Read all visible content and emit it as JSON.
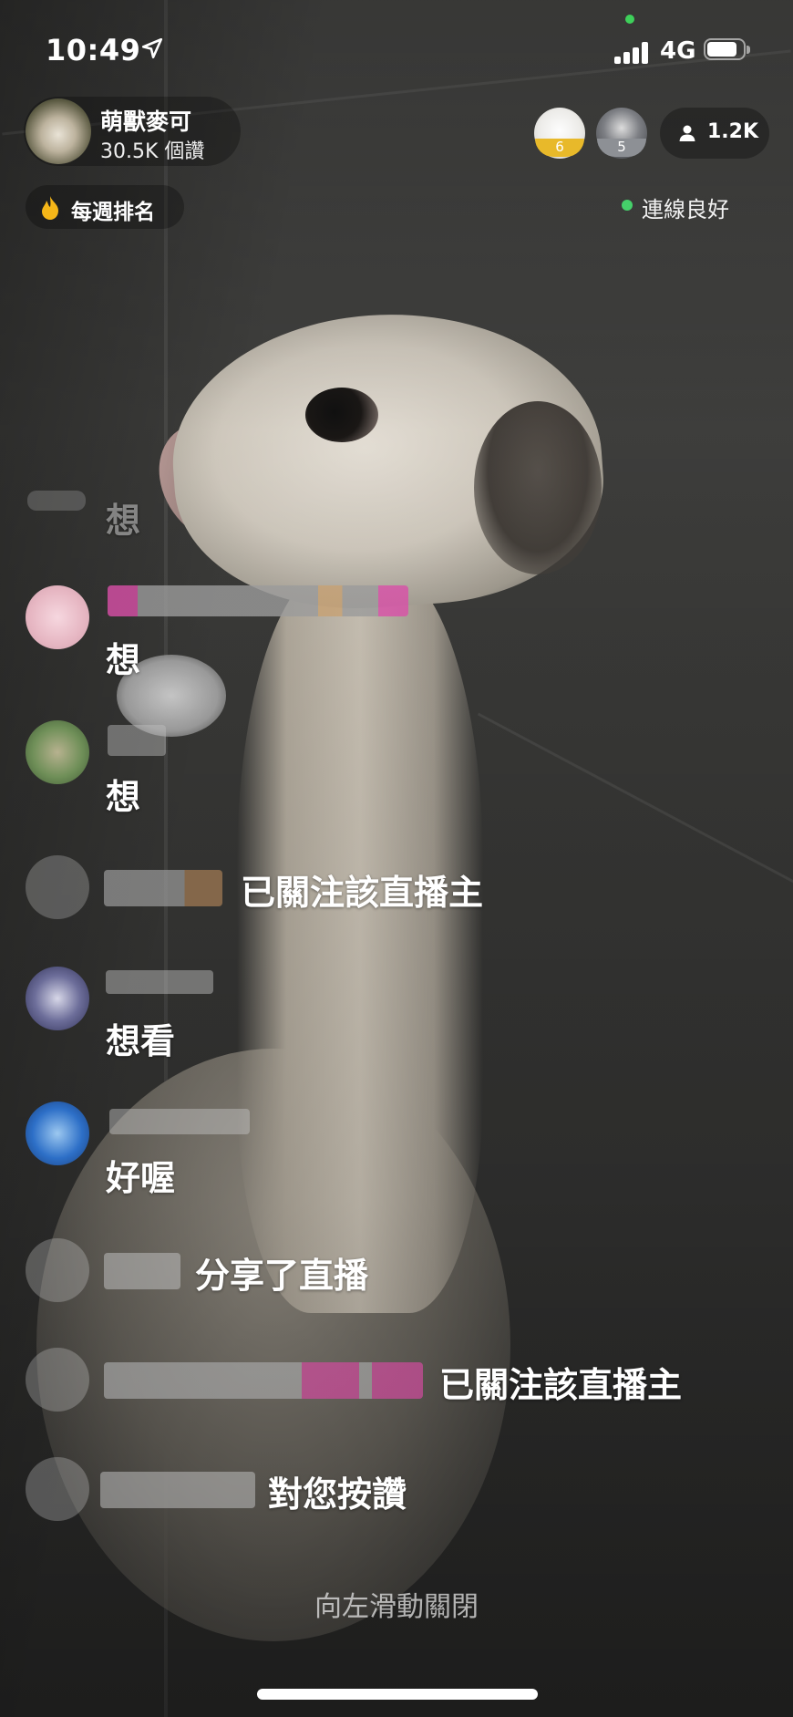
{
  "status_bar": {
    "time": "10:49",
    "network": "4G",
    "location_icon": "location-arrow-icon",
    "signal_icon": "signal-bars-icon",
    "battery_icon": "battery-icon"
  },
  "host": {
    "name": "萌獸麥可",
    "likes": "30.5K 個讚"
  },
  "viewers": {
    "top": [
      {
        "badge": "6",
        "badge_color": "#e8b92a"
      },
      {
        "badge": "5",
        "badge_color": "#8d9095"
      }
    ],
    "count": "1.2K"
  },
  "weekly_rank": {
    "label": "每週排名",
    "icon": "flame-icon"
  },
  "connection": {
    "label": "連線良好",
    "dot_color": "#45d06a"
  },
  "chat": {
    "messages": [
      {
        "text": "想"
      },
      {
        "text": "想"
      },
      {
        "text": "想"
      },
      {
        "text": "已關注該直播主"
      },
      {
        "text": "想看"
      },
      {
        "text": "好喔"
      },
      {
        "text": "分享了直播"
      },
      {
        "text": "已關注該直播主"
      },
      {
        "text": "對您按讚"
      }
    ]
  },
  "hint": "向左滑動關閉"
}
